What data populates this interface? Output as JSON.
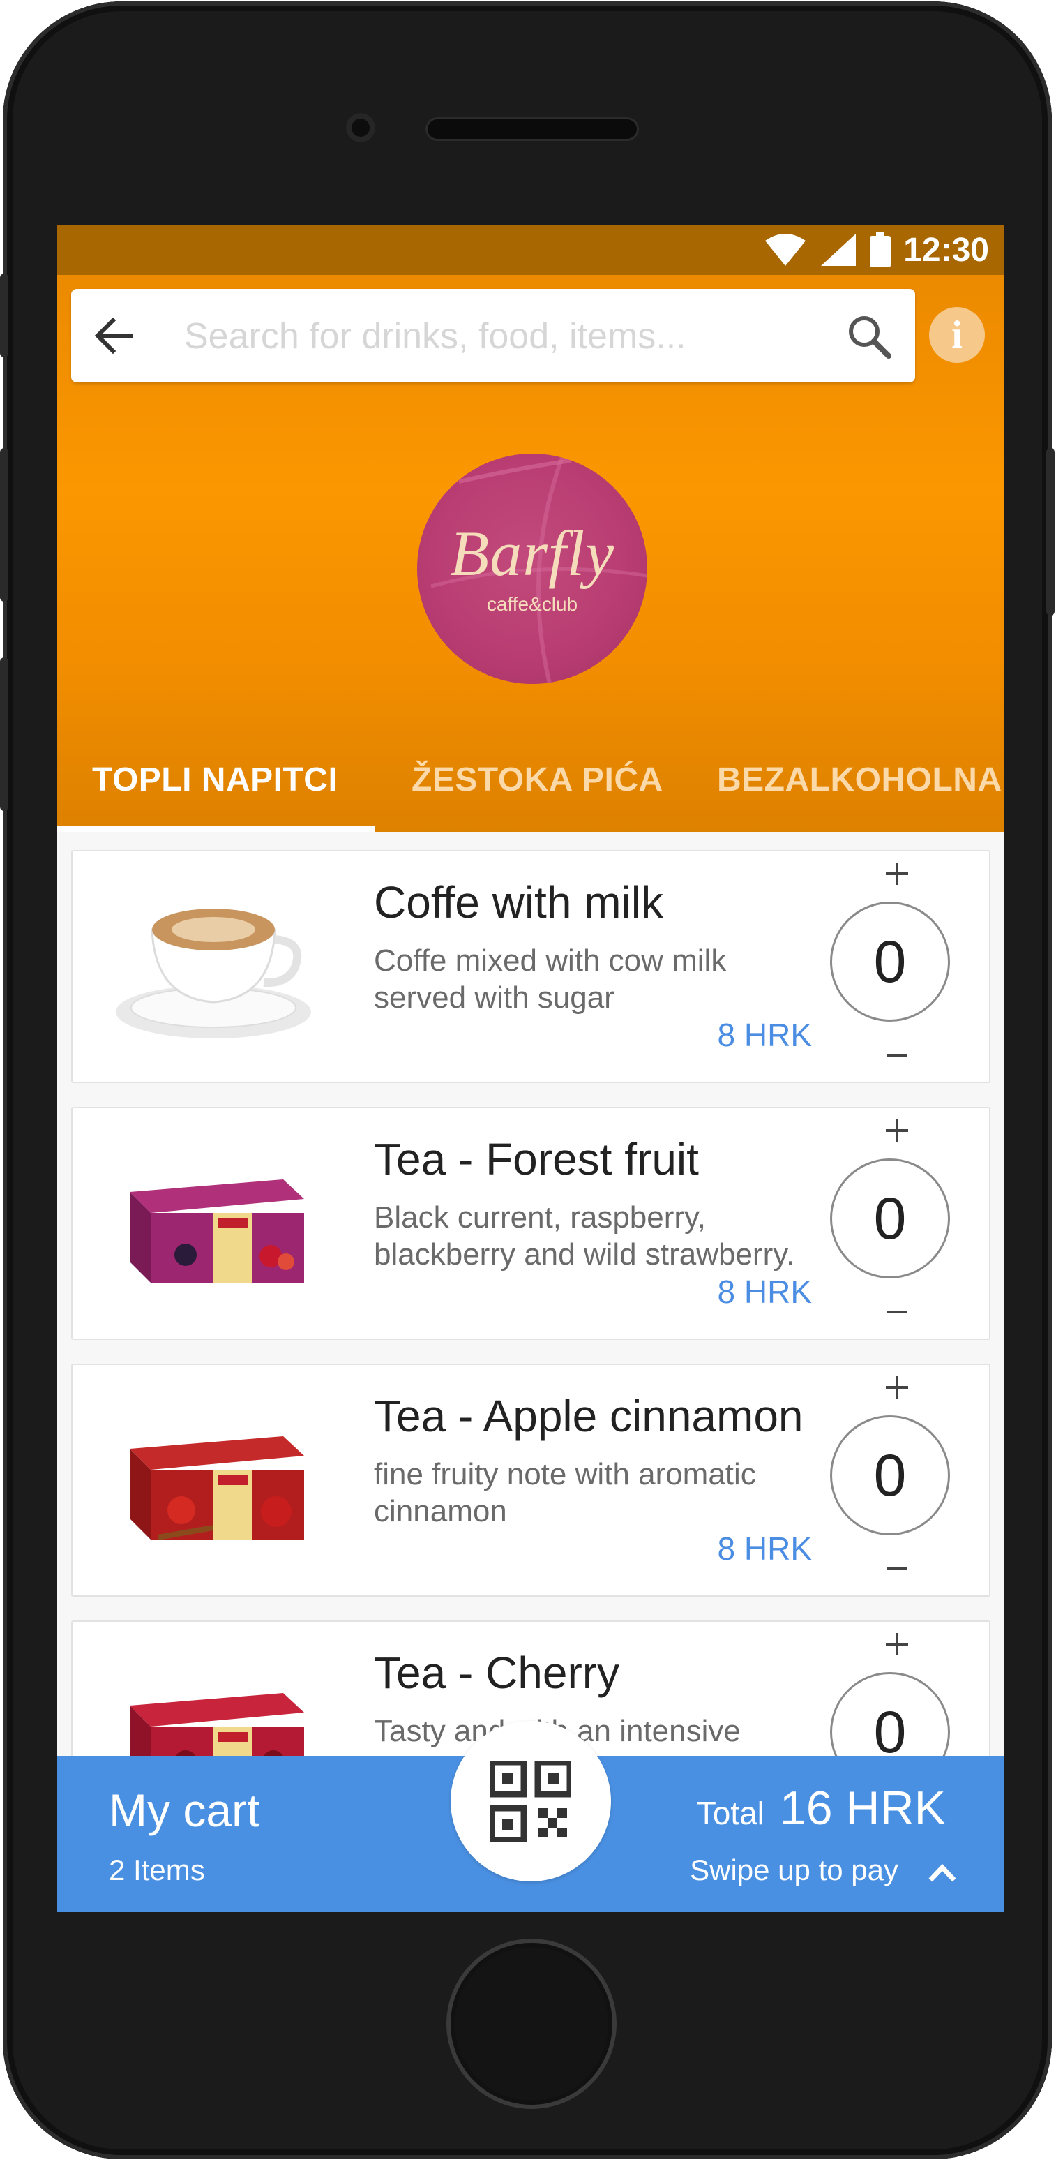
{
  "status_bar": {
    "time": "12:30"
  },
  "search": {
    "placeholder": "Search for drinks, food, items..."
  },
  "venue": {
    "logo_text": "Barfly",
    "logo_subtext": "caffe&club"
  },
  "tabs": [
    {
      "label": "TOPLI NAPITCI",
      "active": true
    },
    {
      "label": "ŽESTOKA PIĆA",
      "active": false
    },
    {
      "label": "BEZALKOHOLNA",
      "active": false
    }
  ],
  "items": [
    {
      "title": "Coffe with milk",
      "description": "Coffe mixed with cow milk served with sugar",
      "price": "8 HRK",
      "quantity": "0",
      "image": "coffee-cup"
    },
    {
      "title": "Tea - Forest fruit",
      "description": "Black current, raspberry, blackberry and wild strawberry.",
      "price": "8 HRK",
      "quantity": "0",
      "image": "tea-box-forest-fruit"
    },
    {
      "title": "Tea - Apple cinnamon",
      "description": "fine fruity note with aromatic cinnamon",
      "price": "8 HRK",
      "quantity": "0",
      "image": "tea-box-apple-cinnamon"
    },
    {
      "title": "Tea - Cherry",
      "description": "Tasty and with an intensive",
      "price": "",
      "quantity": "0",
      "image": "tea-box-cherry"
    }
  ],
  "cart": {
    "title": "My cart",
    "items_count": "2 Items",
    "total_label": "Total",
    "total_value": "16 HRK",
    "swipe_hint": "Swipe up to pay"
  },
  "colors": {
    "header_orange": "#fb9700",
    "status_bar": "#a86700",
    "cart_blue": "#4a90e2",
    "price_blue": "#4a8de3",
    "logo_pink": "#b93d72"
  },
  "icons": [
    "back-arrow-icon",
    "search-icon",
    "info-icon",
    "plus-icon",
    "minus-icon",
    "qr-code-icon",
    "chevron-up-icon",
    "wifi-icon",
    "signal-icon",
    "battery-icon"
  ]
}
